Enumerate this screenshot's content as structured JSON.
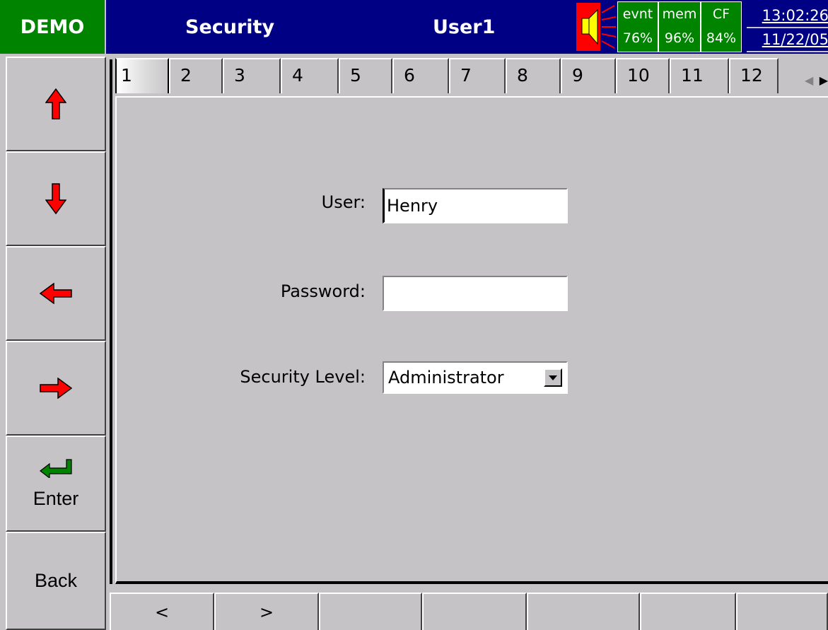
{
  "header": {
    "demo_label": "DEMO",
    "screen_title": "Security",
    "user_title": "User1",
    "stats": [
      {
        "name": "evnt",
        "value": "76%"
      },
      {
        "name": "mem",
        "value": "96%"
      },
      {
        "name": "CF",
        "value": "84%"
      }
    ],
    "time": "13:02:26",
    "date": "11/22/05"
  },
  "sidebar": {
    "up_icon": "up-arrow-icon",
    "down_icon": "down-arrow-icon",
    "left_icon": "left-arrow-icon",
    "right_icon": "right-arrow-icon",
    "enter_label": "Enter",
    "back_label": "Back"
  },
  "tabs": [
    "1",
    "2",
    "3",
    "4",
    "5",
    "6",
    "7",
    "8",
    "9",
    "10",
    "11",
    "12"
  ],
  "active_tab": "1",
  "form": {
    "user_label": "User:",
    "user_value": "Henry",
    "password_label": "Password:",
    "password_value": "",
    "level_label": "Security Level:",
    "level_value": "Administrator"
  },
  "softkeys": [
    "<",
    ">",
    "",
    "",
    "",
    "",
    ""
  ],
  "colors": {
    "header_bg": "#000084",
    "demo_bg": "#008400",
    "arrow_red": "#ff0000",
    "enter_green": "#008400",
    "panel_bg": "#c6c3c6"
  }
}
